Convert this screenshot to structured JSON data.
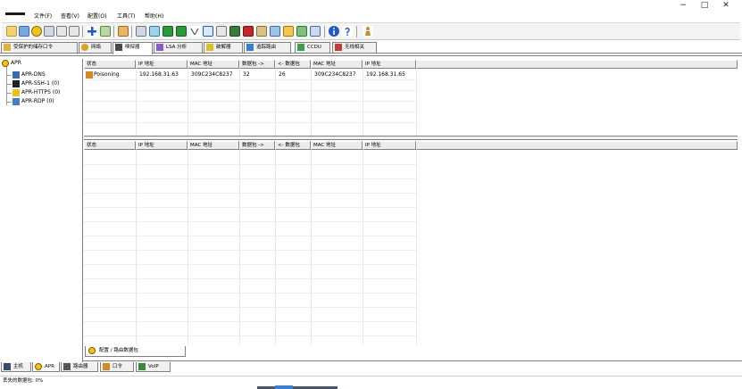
{
  "window": {
    "controls": {
      "minimize": "−",
      "maximize": "□",
      "close": "✕"
    }
  },
  "menu": {
    "items": [
      "文件(F)",
      "查看(V)",
      "配置(O)",
      "工具(T)",
      "帮助(H)"
    ]
  },
  "toolbar": {
    "icons": [
      "open-icon",
      "save-icon",
      "apr-icon",
      "network-icon",
      "hex-icon",
      "hex2-icon",
      "add-icon",
      "sniffer-icon",
      "route-icon",
      "scan-icon",
      "base64-icon",
      "hash-icon",
      "terminal-icon",
      "wifi-icon",
      "cert-icon",
      "dots-icon",
      "monitor-icon",
      "laptop-icon",
      "tool-icon",
      "users-icon",
      "key-icon",
      "filter-icon",
      "chart-icon",
      "info-icon",
      "help-icon",
      "person-icon"
    ]
  },
  "tabs": [
    "受保护的储存口令",
    "网络",
    "嗅探器",
    "LSA 分析",
    "破解器",
    "追踪路由",
    "CCDU",
    "无线相关"
  ],
  "tree": {
    "root": "APR",
    "children": [
      "APR-DNS",
      "APR-SSH-1 (0)",
      "APR-HTTPS (0)",
      "APR-RDP (0)"
    ]
  },
  "grid_top": {
    "headers": [
      "状态",
      "IP 地址",
      "MAC 地址",
      "数据包 ->",
      "<- 数据包",
      "MAC 地址",
      "IP 地址"
    ],
    "rows": [
      [
        "Poisoning",
        "192.168.31.63",
        "309C234C8237",
        "32",
        "26",
        "309C234C8237",
        "192.168.31.65"
      ]
    ]
  },
  "grid_bottom": {
    "headers": [
      "状态",
      "IP 地址",
      "MAC 地址",
      "数据包 ->",
      "<- 数据包",
      "MAC 地址",
      "IP 地址"
    ],
    "rows": []
  },
  "bottom_tab": {
    "label": "配置 / 路由数据包"
  },
  "view_tabs": [
    "主机",
    "APR",
    "路由器",
    "口令",
    "VoIP"
  ],
  "status": {
    "text": "丢失的数据包: 0%"
  },
  "colors": {
    "accent": "#1f58c8",
    "warn": "#e8c21a",
    "green": "#2d9a3a",
    "red": "#c8242c"
  }
}
